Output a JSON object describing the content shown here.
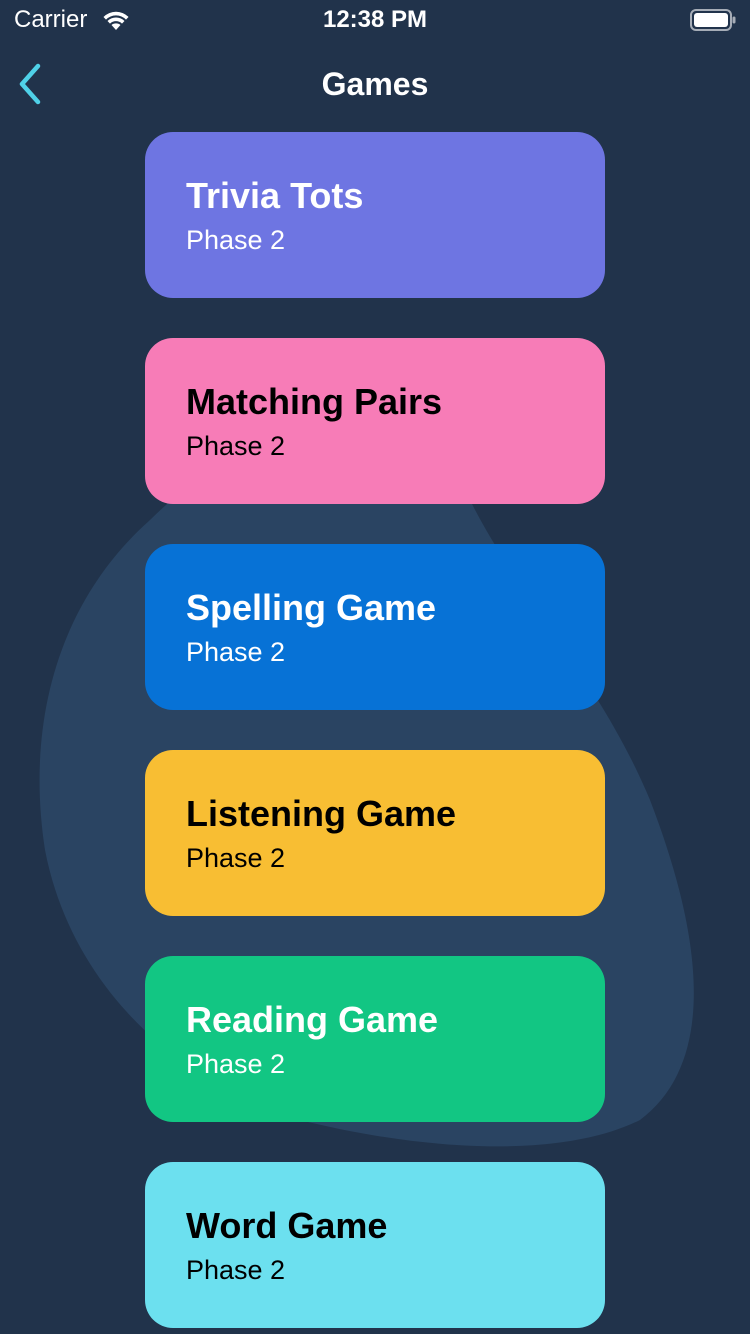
{
  "status_bar": {
    "carrier": "Carrier",
    "time": "12:38 PM",
    "icons": [
      "wifi-icon",
      "battery-icon"
    ]
  },
  "nav": {
    "title": "Games",
    "back_icon": "chevron-left-icon"
  },
  "colors": {
    "background": "#21334b",
    "blob": "#2a4462",
    "back_accent": "#4fd1e8"
  },
  "games": [
    {
      "title": "Trivia Tots",
      "phase": "Phase 2",
      "color": "#6e75e2",
      "text_color": "#ffffff"
    },
    {
      "title": "Matching Pairs",
      "phase": "Phase 2",
      "color": "#f77cb7",
      "text_color": "#000000"
    },
    {
      "title": "Spelling Game",
      "phase": "Phase 2",
      "color": "#0772d6",
      "text_color": "#ffffff"
    },
    {
      "title": "Listening Game",
      "phase": "Phase 2",
      "color": "#f8be33",
      "text_color": "#000000"
    },
    {
      "title": "Reading Game",
      "phase": "Phase 2",
      "color": "#12c683",
      "text_color": "#ffffff"
    },
    {
      "title": "Word Game",
      "phase": "Phase 2",
      "color": "#6ce0ef",
      "text_color": "#000000"
    }
  ]
}
